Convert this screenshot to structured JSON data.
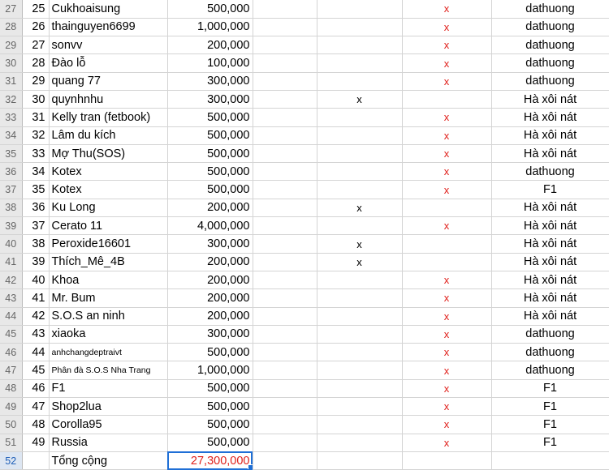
{
  "rows": [
    {
      "row": "27",
      "n": "25",
      "name": "Cukhoaisung",
      "amount": "500,000",
      "x1": "",
      "x2": "x",
      "group": "dathuong",
      "small": false
    },
    {
      "row": "28",
      "n": "26",
      "name": "thainguyen6699",
      "amount": "1,000,000",
      "x1": "",
      "x2": "x",
      "group": "dathuong",
      "small": false
    },
    {
      "row": "29",
      "n": "27",
      "name": "sonvv",
      "amount": "200,000",
      "x1": "",
      "x2": "x",
      "group": "dathuong",
      "small": false
    },
    {
      "row": "30",
      "n": "28",
      "name": "Đào lỗ",
      "amount": "100,000",
      "x1": "",
      "x2": "x",
      "group": "dathuong",
      "small": false
    },
    {
      "row": "31",
      "n": "29",
      "name": "quang 77",
      "amount": "300,000",
      "x1": "",
      "x2": "x",
      "group": "dathuong",
      "small": false
    },
    {
      "row": "32",
      "n": "30",
      "name": "quynhnhu",
      "amount": "300,000",
      "x1": "x",
      "x2": "",
      "group": "Hà xôi nát",
      "small": false
    },
    {
      "row": "33",
      "n": "31",
      "name": "Kelly tran (fetbook)",
      "amount": "500,000",
      "x1": "",
      "x2": "x",
      "group": "Hà xôi nát",
      "small": false
    },
    {
      "row": "34",
      "n": "32",
      "name": "Lâm du kích",
      "amount": "500,000",
      "x1": "",
      "x2": "x",
      "group": "Hà xôi nát",
      "small": false
    },
    {
      "row": "35",
      "n": "33",
      "name": "Mợ Thu(SOS)",
      "amount": "500,000",
      "x1": "",
      "x2": "x",
      "group": "Hà xôi nát",
      "small": false
    },
    {
      "row": "36",
      "n": "34",
      "name": "Kotex",
      "amount": "500,000",
      "x1": "",
      "x2": "x",
      "group": "dathuong",
      "small": false
    },
    {
      "row": "37",
      "n": "35",
      "name": "Kotex",
      "amount": "500,000",
      "x1": "",
      "x2": "x",
      "group": "F1",
      "small": false
    },
    {
      "row": "38",
      "n": "36",
      "name": "Ku Long",
      "amount": "200,000",
      "x1": "x",
      "x2": "",
      "group": "Hà xôi nát",
      "small": false
    },
    {
      "row": "39",
      "n": "37",
      "name": "Cerato 11",
      "amount": "4,000,000",
      "x1": "",
      "x2": "x",
      "group": "Hà xôi nát",
      "small": false
    },
    {
      "row": "40",
      "n": "38",
      "name": "Peroxide16601",
      "amount": "300,000",
      "x1": "x",
      "x2": "",
      "group": "Hà xôi nát",
      "small": false
    },
    {
      "row": "41",
      "n": "39",
      "name": "Thích_Mê_4B",
      "amount": "200,000",
      "x1": "x",
      "x2": "",
      "group": "Hà xôi nát",
      "small": false
    },
    {
      "row": "42",
      "n": "40",
      "name": "Khoa",
      "amount": "200,000",
      "x1": "",
      "x2": "x",
      "group": "Hà xôi nát",
      "small": false
    },
    {
      "row": "43",
      "n": "41",
      "name": "Mr. Bum",
      "amount": "200,000",
      "x1": "",
      "x2": "x",
      "group": "Hà xôi nát",
      "small": false
    },
    {
      "row": "44",
      "n": "42",
      "name": "S.O.S an ninh",
      "amount": "200,000",
      "x1": "",
      "x2": "x",
      "group": "Hà xôi nát",
      "small": false
    },
    {
      "row": "45",
      "n": "43",
      "name": "xiaoka",
      "amount": "300,000",
      "x1": "",
      "x2": "x",
      "group": "dathuong",
      "small": false
    },
    {
      "row": "46",
      "n": "44",
      "name": "anhchangdeptraivt",
      "amount": "500,000",
      "x1": "",
      "x2": "x",
      "group": "dathuong",
      "small": true
    },
    {
      "row": "47",
      "n": "45",
      "name": "Phân đà S.O.S Nha Trang",
      "amount": "1,000,000",
      "x1": "",
      "x2": "x",
      "group": "dathuong",
      "small": true
    },
    {
      "row": "48",
      "n": "46",
      "name": "F1",
      "amount": "500,000",
      "x1": "",
      "x2": "x",
      "group": "F1",
      "small": false
    },
    {
      "row": "49",
      "n": "47",
      "name": "Shop2lua",
      "amount": "500,000",
      "x1": "",
      "x2": "x",
      "group": "F1",
      "small": false
    },
    {
      "row": "50",
      "n": "48",
      "name": "Corolla95",
      "amount": "500,000",
      "x1": "",
      "x2": "x",
      "group": "F1",
      "small": false
    },
    {
      "row": "51",
      "n": "49",
      "name": "Russia",
      "amount": "500,000",
      "x1": "",
      "x2": "x",
      "group": "F1",
      "small": false
    }
  ],
  "total": {
    "row": "52",
    "label": "Tổng cộng",
    "amount": "27,300,000"
  }
}
